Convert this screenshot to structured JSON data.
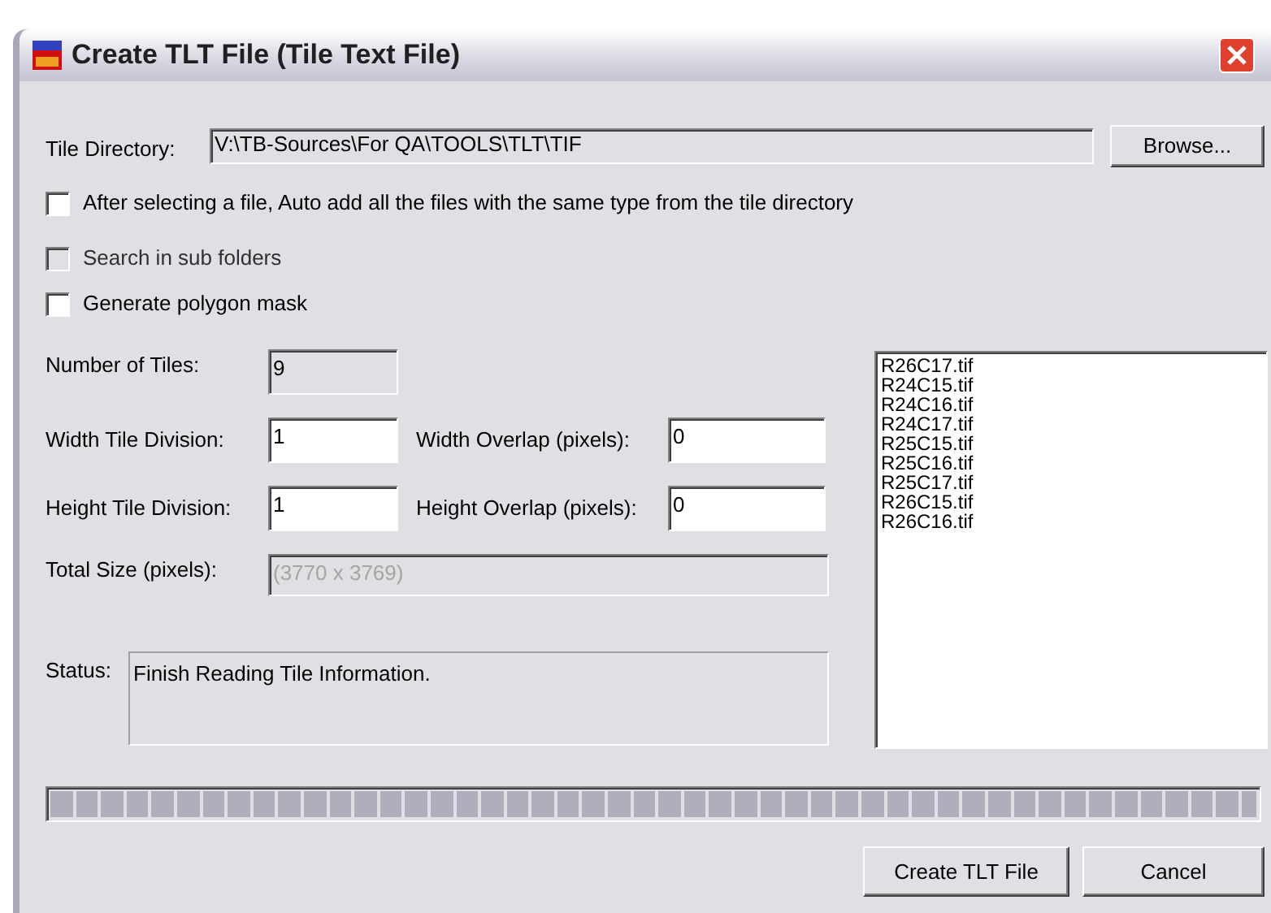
{
  "window": {
    "title": "Create TLT File (Tile Text File)"
  },
  "tile_directory": {
    "label": "Tile Directory:",
    "value": "V:\\TB-Sources\\For QA\\TOOLS\\TLT\\TIF",
    "button": "Browse..."
  },
  "options": [
    {
      "label": "After selecting a file, Auto add all the files with the same type from the tile directory",
      "checked": false,
      "disabled": false
    },
    {
      "label": "Search in sub folders",
      "checked": false,
      "disabled": true
    },
    {
      "label": "Generate polygon mask",
      "checked": false,
      "disabled": false
    }
  ],
  "number_of_tiles": {
    "label": "Number of Tiles:",
    "value": "9"
  },
  "width_tile_division": {
    "label": "Width Tile Division:",
    "value": "1"
  },
  "width_overlap": {
    "label": "Width Overlap (pixels):",
    "value": "0"
  },
  "height_tile_division": {
    "label": "Height Tile Division:",
    "value": "1"
  },
  "height_overlap": {
    "label": "Height Overlap (pixels):",
    "value": "0"
  },
  "total_size": {
    "label": "Total Size (pixels):",
    "value": "(3770 x 3769)"
  },
  "status": {
    "label": "Status:",
    "value": "Finish Reading Tile Information."
  },
  "files": [
    "R26C17.tif",
    "R24C15.tif",
    "R24C16.tif",
    "R24C17.tif",
    "R25C15.tif",
    "R25C16.tif",
    "R25C17.tif",
    "R26C15.tif",
    "R26C16.tif"
  ],
  "progress": {
    "level": 1
  },
  "buttons": [
    "Create TLT File",
    "Cancel"
  ]
}
